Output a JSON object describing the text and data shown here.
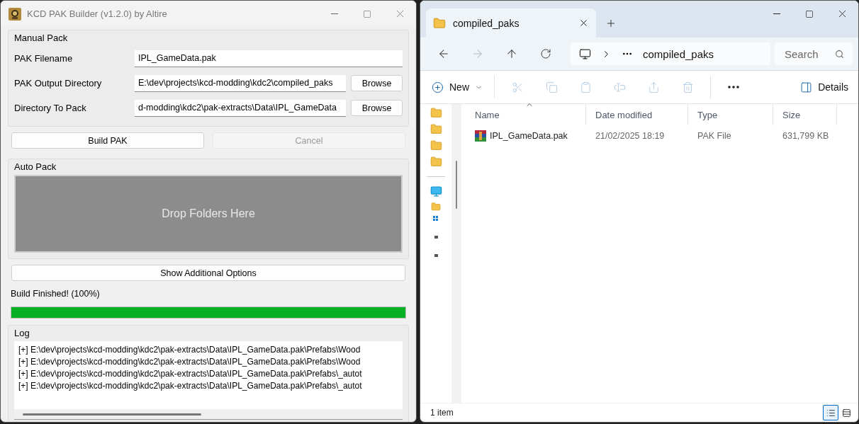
{
  "builder": {
    "title": "KCD PAK Builder (v1.2.0) by Altire",
    "manual_pack": {
      "title": "Manual Pack",
      "fields": [
        {
          "label": "PAK Filename",
          "value": "IPL_GameData.pak"
        },
        {
          "label": "PAK Output Directory",
          "value": "E:\\dev\\projects\\kcd-modding\\kdc2\\compiled_paks",
          "button": "Browse"
        },
        {
          "label": "Directory To Pack",
          "value": "d-modding\\kdc2\\pak-extracts\\Data\\IPL_GameData",
          "button": "Browse"
        }
      ]
    },
    "actions": [
      {
        "label": "Build PAK",
        "disabled": false
      },
      {
        "label": "Cancel",
        "disabled": true
      }
    ],
    "auto_pack": {
      "title": "Auto Pack",
      "drop_zone": "Drop Folders Here"
    },
    "options_button": "Show Additional Options",
    "status": "Build Finished! (100%)",
    "progress": {
      "level": 1
    },
    "log": {
      "title": "Log",
      "lines": [
        "[+] E:\\dev\\projects\\kcd-modding\\kdc2\\pak-extracts\\Data\\IPL_GameData.pak\\Prefabs\\Wood",
        "[+] E:\\dev\\projects\\kcd-modding\\kdc2\\pak-extracts\\Data\\IPL_GameData.pak\\Prefabs\\Wood",
        "[+] E:\\dev\\projects\\kcd-modding\\kdc2\\pak-extracts\\Data\\IPL_GameData.pak\\Prefabs\\_autot",
        "[+] E:\\dev\\projects\\kcd-modding\\kdc2\\pak-extracts\\Data\\IPL_GameData.pak\\Prefabs\\_autot"
      ]
    }
  },
  "explorer": {
    "tab": {
      "title": "compiled_paks"
    },
    "breadcrumb": {
      "current": "compiled_paks"
    },
    "search": {
      "placeholder": "Search"
    },
    "toolbar": {
      "new": "New",
      "actions": [
        {
          "kind": "cut",
          "disabled": true
        },
        {
          "kind": "copy",
          "disabled": true
        },
        {
          "kind": "paste",
          "disabled": true
        },
        {
          "kind": "rename",
          "disabled": true
        },
        {
          "kind": "share",
          "disabled": true
        },
        {
          "kind": "delete",
          "disabled": true
        }
      ],
      "details": "Details"
    },
    "columns": [
      {
        "label": "Name",
        "sorted": true
      },
      {
        "label": "Date modified",
        "sorted": false
      },
      {
        "label": "Type",
        "sorted": false
      },
      {
        "label": "Size",
        "sorted": false
      }
    ],
    "files": [
      {
        "name": "IPL_GameData.pak",
        "date": "21/02/2025 18:19",
        "type": "PAK File",
        "size": "631,799 KB",
        "selected": false
      }
    ],
    "status": "1 item",
    "views": [
      {
        "kind": "details",
        "selected": true
      },
      {
        "kind": "tiles",
        "selected": false
      }
    ]
  }
}
